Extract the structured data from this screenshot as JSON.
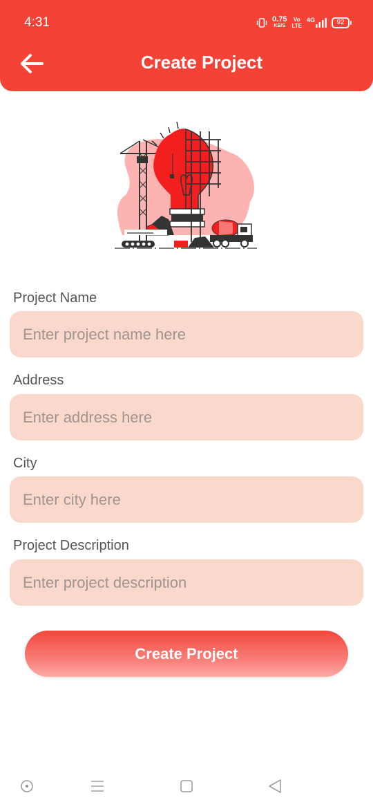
{
  "status_bar": {
    "time": "4:31",
    "net_speed_value": "0.75",
    "net_speed_unit": "KB/S",
    "volte_top": "Vo",
    "volte_bottom": "LTE",
    "network_type": "4G",
    "battery": "92"
  },
  "header": {
    "title": "Create Project",
    "back_icon": "arrow-left-icon",
    "background_color": "#f44336"
  },
  "illustration": {
    "icon": "construction-lightbulb-illustration"
  },
  "form": {
    "project_name": {
      "label": "Project Name",
      "placeholder": "Enter project name here",
      "value": ""
    },
    "address": {
      "label": "Address",
      "placeholder": "Enter address here",
      "value": ""
    },
    "city": {
      "label": "City",
      "placeholder": "Enter city here",
      "value": ""
    },
    "description": {
      "label": "Project Description",
      "placeholder": "Enter project description",
      "value": ""
    },
    "field_color": "#fad9cc"
  },
  "submit": {
    "label": "Create Project",
    "color": "#f2473c"
  },
  "nav_bar": {
    "items": [
      "record-icon",
      "menu-icon",
      "home-square-icon",
      "back-triangle-icon"
    ]
  }
}
